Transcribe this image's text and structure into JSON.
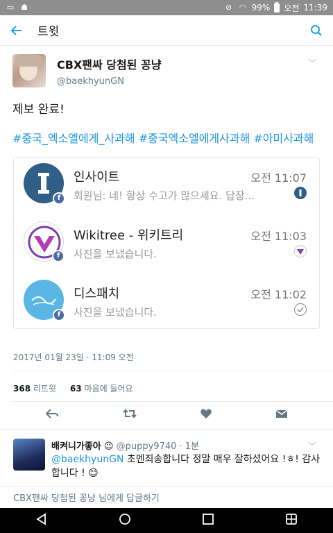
{
  "status_bar": {
    "battery": "99%",
    "ampm": "오전",
    "time": "11:39"
  },
  "app_bar": {
    "title": "트윗"
  },
  "tweet": {
    "display_name": "CBX팬싸 당첨된 꽁냥",
    "handle": "@baekhyunGN",
    "text": "제보 완료!",
    "hashtags": "#중국_엑소엘에게_사과해 #중국엑소엘에게사과해 #아미사과해",
    "timestamp": "2017년 01월 23일 · 11:09 오전",
    "retweets_count": "368",
    "retweets_label": "리트윗",
    "likes_count": "63",
    "likes_label": "마음에 들어요"
  },
  "card": {
    "chats": [
      {
        "name": "인사이트",
        "time": "오전 11:07",
        "message": "회원님: 네! 항상 수고가 많으세요. 답장...",
        "avatar_icon": "insight-logo-icon"
      },
      {
        "name": "Wikitree - 위키트리",
        "time": "오전 11:03",
        "message": "사진을 보냈습니다.",
        "avatar_icon": "wikitree-logo-icon"
      },
      {
        "name": "디스패치",
        "time": "오전 11:02",
        "message": "사진을 보냈습니다.",
        "avatar_icon": "dispatch-logo-icon"
      }
    ]
  },
  "reply": {
    "display_name": "배켜니가좋아",
    "emoji": "😉",
    "handle": "@puppy9740",
    "time": "· 1분",
    "mention": "@baekhyunGN",
    "text": " 초멘죄송합니다 정말 매우 잘하셨어요 !ㅎ! 감사합니다 ! 😊"
  },
  "reply_box": {
    "placeholder": "CBX팬싸 당첨된 꽁냥 님에게 답글하기"
  },
  "colors": {
    "accent": "#1da1f2",
    "link": "#1b95e0",
    "status_bar": "#8e8e8e"
  }
}
